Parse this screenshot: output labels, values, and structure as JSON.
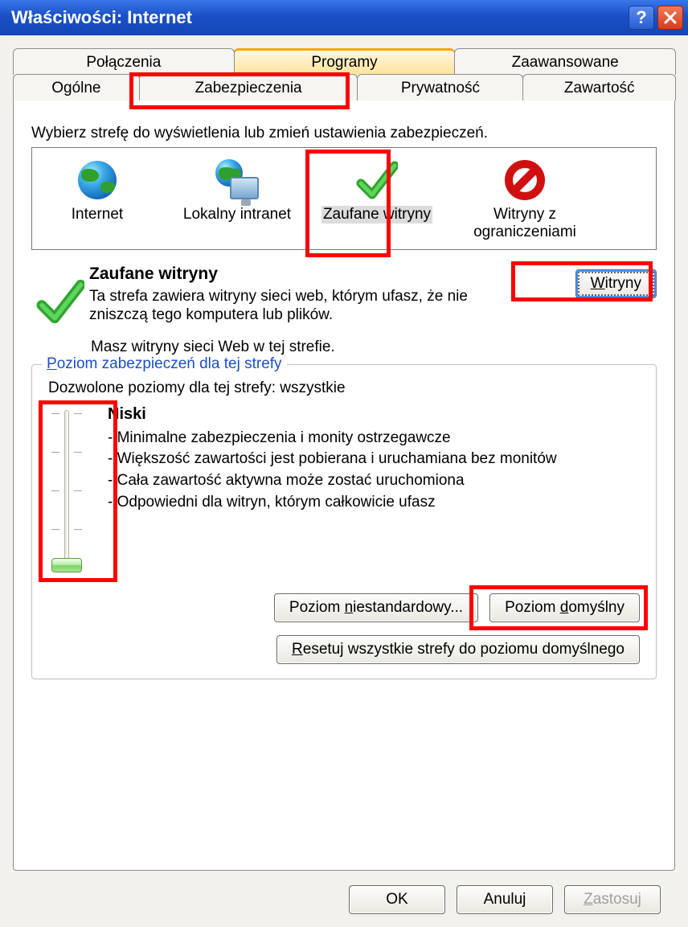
{
  "window": {
    "title": "Właściwości: Internet"
  },
  "tabs_row1": {
    "0": "Połączenia",
    "1": "Programy",
    "2": "Zaawansowane"
  },
  "tabs_row2": {
    "0": "Ogólne",
    "1": "Zabezpieczenia",
    "2": "Prywatność",
    "3": "Zawartość"
  },
  "zone_prompt": "Wybierz strefę do wyświetlenia lub zmień ustawienia zabezpieczeń.",
  "zones": {
    "internet": "Internet",
    "local": "Lokalny intranet",
    "trusted": "Zaufane witryny",
    "restricted": "Witryny z ograniczeniami"
  },
  "zone_detail": {
    "name": "Zaufane witryny",
    "desc": "Ta strefa zawiera witryny sieci web, którym ufasz, że nie zniszczą tego komputera lub plików.",
    "note": "Masz witryny sieci Web w tej strefie."
  },
  "sites_button": "Witryny",
  "group_legend": "Poziom zabezpieczeń dla tej strefy",
  "allowed_levels": "Dozwolone poziomy dla tej strefy: wszystkie",
  "level": {
    "name": "Niski",
    "b1": "- Minimalne zabezpieczenia i monity ostrzegawcze",
    "b2": "- Większość zawartości jest pobierana i uruchamiana bez monitów",
    "b3": "- Cała zawartość aktywna może zostać uruchomiona",
    "b4": "- Odpowiedni dla witryn, którym całkowicie ufasz"
  },
  "buttons": {
    "custom": "Poziom niestandardowy...",
    "default": "Poziom domyślny",
    "reset": "Resetuj wszystkie strefy do poziomu domyślnego",
    "ok": "OK",
    "cancel": "Anuluj",
    "apply": "Zastosuj"
  }
}
